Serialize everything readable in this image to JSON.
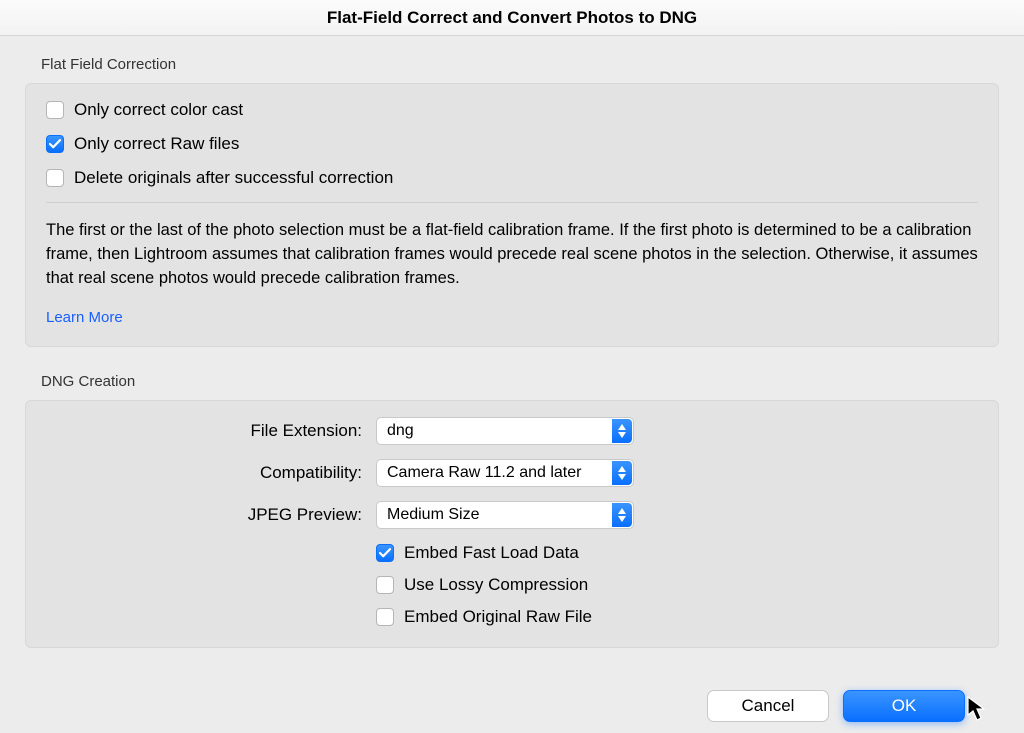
{
  "window": {
    "title": "Flat-Field Correct and Convert Photos to DNG"
  },
  "flatField": {
    "sectionLabel": "Flat Field Correction",
    "options": {
      "colorCast": {
        "label": "Only correct color cast",
        "checked": false
      },
      "rawFiles": {
        "label": "Only correct Raw files",
        "checked": true
      },
      "deleteOriginals": {
        "label": "Delete originals after successful correction",
        "checked": false
      }
    },
    "description": "The first or the last of the photo selection must be a flat-field calibration frame. If the first photo is determined to be a calibration frame, then Lightroom assumes that calibration frames would precede real scene photos in the selection. Otherwise, it assumes that real scene photos would precede calibration frames.",
    "learnMore": "Learn More"
  },
  "dng": {
    "sectionLabel": "DNG Creation",
    "fileExtension": {
      "label": "File Extension:",
      "value": "dng"
    },
    "compatibility": {
      "label": "Compatibility:",
      "value": "Camera Raw 11.2 and later"
    },
    "jpegPreview": {
      "label": "JPEG Preview:",
      "value": "Medium Size"
    },
    "embedFast": {
      "label": "Embed Fast Load Data",
      "checked": true
    },
    "lossy": {
      "label": "Use Lossy Compression",
      "checked": false
    },
    "embedOriginal": {
      "label": "Embed Original Raw File",
      "checked": false
    }
  },
  "footer": {
    "cancel": "Cancel",
    "ok": "OK"
  }
}
